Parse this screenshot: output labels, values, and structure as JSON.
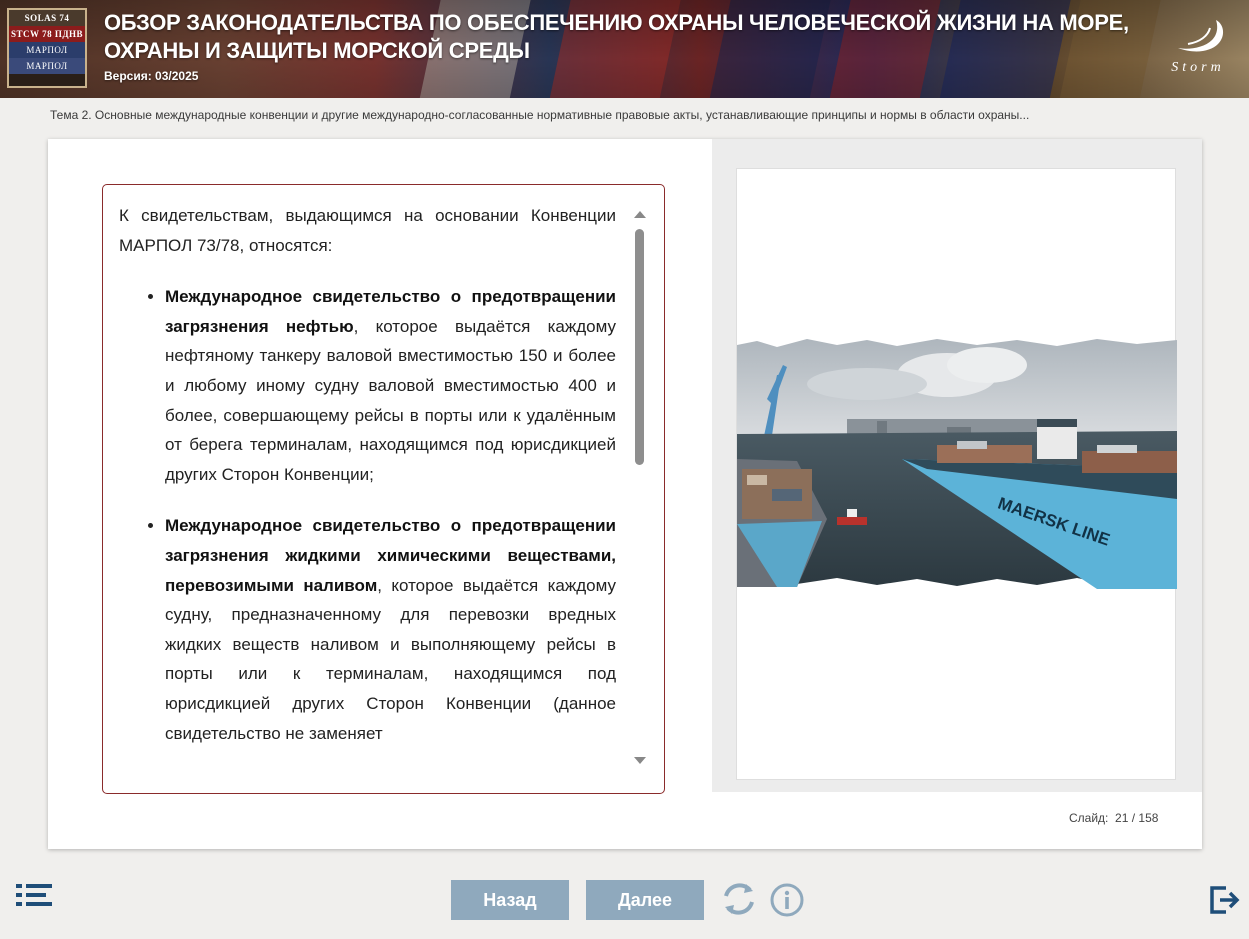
{
  "header": {
    "title": "ОБЗОР ЗАКОНОДАТЕЛЬСТВА ПО ОБЕСПЕЧЕНИЮ ОХРАНЫ ЧЕЛОВЕЧЕСКОЙ ЖИЗНИ НА МОРЕ, ОХРАНЫ И ЗАЩИТЫ МОРСКОЙ СРЕДЫ",
    "version": "Версия: 03/2025",
    "logo_text": "Storm",
    "book_labels": [
      "SOLAS 74",
      "STCW 78 ПДНВ",
      "МАРПОЛ",
      "МАРПОЛ"
    ]
  },
  "breadcrumb": "Тема 2. Основные международные конвенции и другие международно-согласованные нормативные правовые акты, устанавливающие принципы и нормы в области охраны...",
  "content": {
    "intro": "К свидетельствам, выдающимся на основании Конвенции МАРПОЛ 73/78, относятся:",
    "items": [
      {
        "bold": "Международное свидетельство о предотвращении загрязнения нефтью",
        "text": ", которое выдаётся каждому нефтяному танкеру валовой вместимостью 150 и более и любому иному судну валовой вместимостью 400 и более, совершающему рейсы в порты или к удалённым от берега терминалам, находящимся под юрисдикцией других Сторон Конвенции;"
      },
      {
        "bold": "Международное свидетельство о предотвращении загрязнения жидкими химическими веществами, перевозимыми наливом",
        "text": ", которое выдаётся каждому судну, предназначенному для перевозки вредных жидких веществ наливом и выполняющему рейсы в порты или к терминалам, находящимся под юрисдикцией других Сторон Конвенции (данное свидетельство не заменяет"
      }
    ]
  },
  "image": {
    "ship_text": "MAERSK LINE"
  },
  "slide": {
    "label": "Слайд:",
    "current": "21",
    "total": "158",
    "display": "Слайд:  21 / 158"
  },
  "footer": {
    "back_label": "Назад",
    "next_label": "Далее"
  },
  "colors": {
    "button": "#8fa9bd",
    "border": "#8a2b2b",
    "icon": "#1f4e79"
  }
}
